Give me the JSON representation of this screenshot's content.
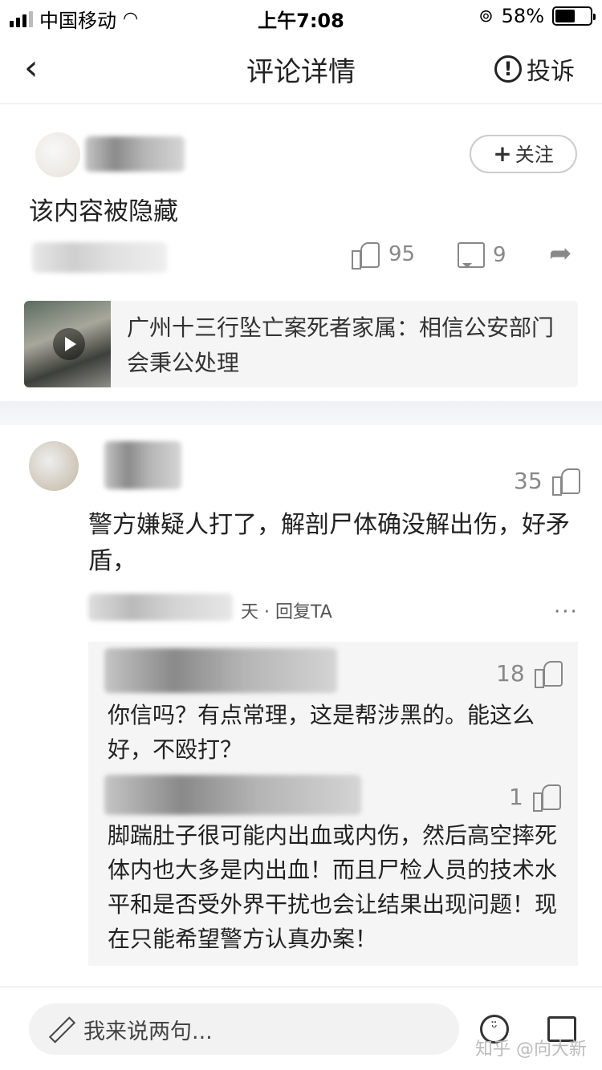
{
  "status_bar": {
    "carrier": "中国移动",
    "time": "上午7:08",
    "battery_pct": "58%",
    "battery_level": 0.58
  },
  "nav": {
    "back_icon": "chevron-left-icon",
    "title": "评论详情",
    "report_label": "投诉",
    "report_icon": "alert-circle-icon"
  },
  "post": {
    "follow_label": "关注",
    "hidden_text": "该内容被隐藏",
    "likes": "95",
    "comments": "9"
  },
  "article": {
    "title": "广州十三行坠亡案死者家属：相信公安部门会秉公处理",
    "thumb_icon": "play-icon"
  },
  "main_comment": {
    "likes": "35",
    "text": "警方嫌疑人打了，解剖尸体确没解出伤，好矛盾，",
    "meta": "天 · 回复TA",
    "more": "···"
  },
  "replies": [
    {
      "likes": "18",
      "text": "你信吗？有点常理，这是帮涉黑的。能这么好，不殴打？"
    },
    {
      "likes": "1",
      "text": "脚踹肚子很可能内出血或内伤，然后高空摔死体内也大多是内出血！而且尸检人员的技术水平和是否受外界干扰也会让结果出现问题！现在只能希望警方认真办案！"
    }
  ],
  "bottom_bar": {
    "input_placeholder": "我来说两句...",
    "emoji_icon": "emoji-icon",
    "image_icon": "image-icon"
  },
  "watermark": "知乎 @向大新"
}
